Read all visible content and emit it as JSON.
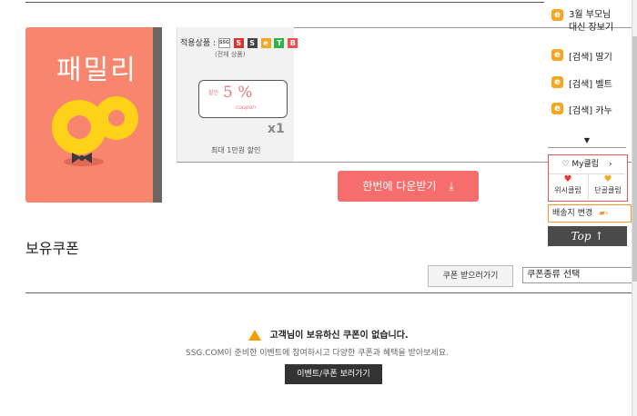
{
  "book": {
    "title": "패밀리"
  },
  "coupon_panel": {
    "apply_label": "적용상품 :",
    "stores": [
      {
        "label": "SSG",
        "color": "#ffffff",
        "text": "#555555"
      },
      {
        "label": "S",
        "color": "#e03131",
        "text": "#ffffff"
      },
      {
        "label": "S",
        "color": "#444444",
        "text": "#ffffff"
      },
      {
        "label": "e",
        "color": "#f5a623",
        "text": "#ffffff"
      },
      {
        "label": "T",
        "color": "#2fb24a",
        "text": "#ffffff"
      },
      {
        "label": "B",
        "color": "#f05050",
        "text": "#ffffff"
      }
    ],
    "scope": "(전체 상품)",
    "coupon_prefix": "할인",
    "coupon_value": "5 %",
    "coupon_word": "coupon",
    "count": "x1",
    "max_discount": "최대 1만원 할인"
  },
  "download_button": {
    "label": "한번에 다운받기"
  },
  "section": {
    "title": "보유쿠폰"
  },
  "controls": {
    "get_button": "쿠폰 받으러가기",
    "select_value": "쿠폰종류 선택"
  },
  "empty_state": {
    "message": "고객님이 보유하신 쿠폰이 없습니다.",
    "description": "SSG.COM이 준비한 이벤트에 참여하시고 다양한 쿠폰과 혜택을 받아보세요.",
    "button": "이벤트/쿠폰 보러가기"
  },
  "sidebar": {
    "history": [
      {
        "icon": "e",
        "line1": "3월 부모님",
        "line2": "대신 장보기"
      },
      {
        "icon": "e",
        "line1": "[검색] 딸기",
        "line2": ""
      },
      {
        "icon": "e",
        "line1": "[검색] 벨트",
        "line2": ""
      },
      {
        "icon": "e",
        "line1": "[검색] 카누",
        "line2": ""
      }
    ],
    "myclip": "My클립",
    "wish": "위시클립",
    "regular": "단골클립",
    "delivery": "배송지 변경",
    "top": "Top ↑"
  }
}
